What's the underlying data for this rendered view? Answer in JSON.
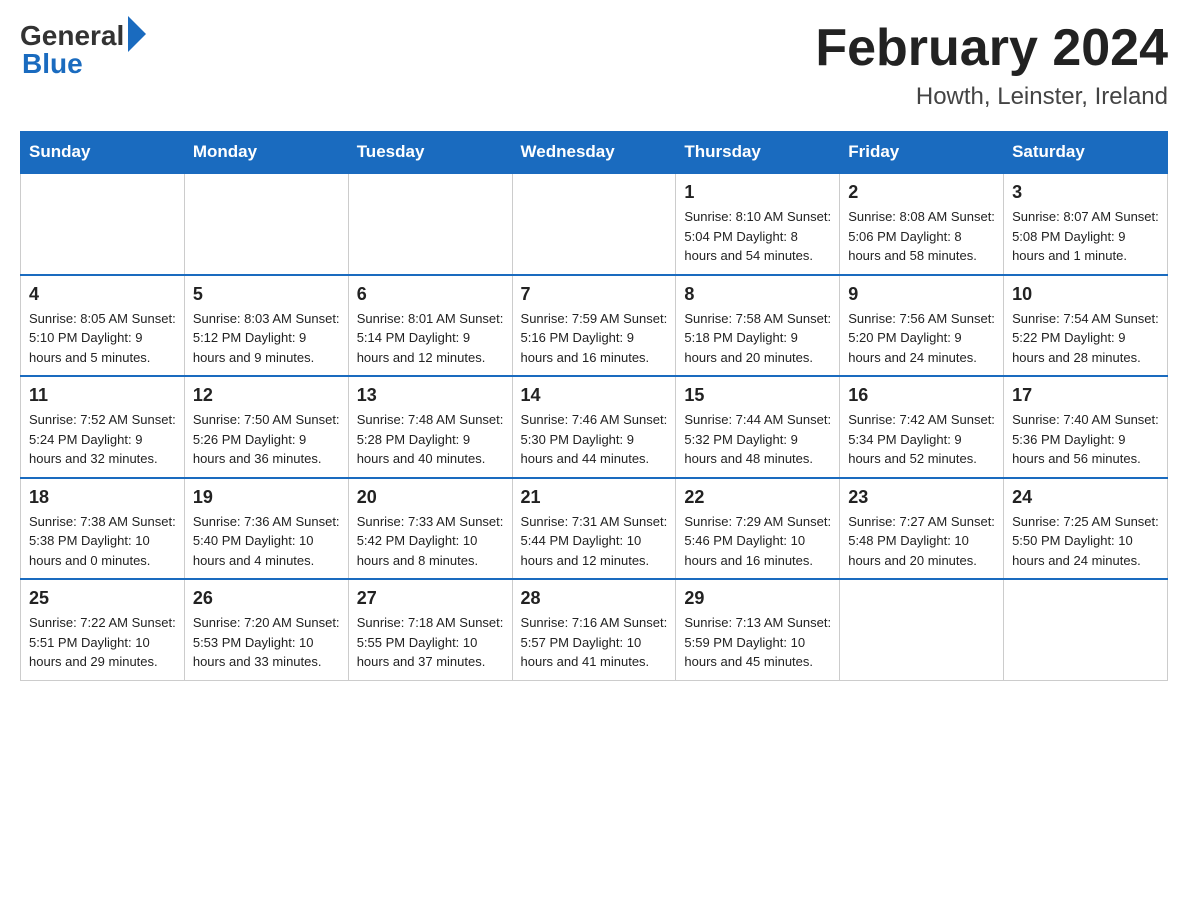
{
  "header": {
    "logo_general": "General",
    "logo_blue": "Blue",
    "title": "February 2024",
    "subtitle": "Howth, Leinster, Ireland"
  },
  "days_of_week": [
    "Sunday",
    "Monday",
    "Tuesday",
    "Wednesday",
    "Thursday",
    "Friday",
    "Saturday"
  ],
  "weeks": [
    [
      {
        "day": "",
        "info": ""
      },
      {
        "day": "",
        "info": ""
      },
      {
        "day": "",
        "info": ""
      },
      {
        "day": "",
        "info": ""
      },
      {
        "day": "1",
        "info": "Sunrise: 8:10 AM\nSunset: 5:04 PM\nDaylight: 8 hours\nand 54 minutes."
      },
      {
        "day": "2",
        "info": "Sunrise: 8:08 AM\nSunset: 5:06 PM\nDaylight: 8 hours\nand 58 minutes."
      },
      {
        "day": "3",
        "info": "Sunrise: 8:07 AM\nSunset: 5:08 PM\nDaylight: 9 hours\nand 1 minute."
      }
    ],
    [
      {
        "day": "4",
        "info": "Sunrise: 8:05 AM\nSunset: 5:10 PM\nDaylight: 9 hours\nand 5 minutes."
      },
      {
        "day": "5",
        "info": "Sunrise: 8:03 AM\nSunset: 5:12 PM\nDaylight: 9 hours\nand 9 minutes."
      },
      {
        "day": "6",
        "info": "Sunrise: 8:01 AM\nSunset: 5:14 PM\nDaylight: 9 hours\nand 12 minutes."
      },
      {
        "day": "7",
        "info": "Sunrise: 7:59 AM\nSunset: 5:16 PM\nDaylight: 9 hours\nand 16 minutes."
      },
      {
        "day": "8",
        "info": "Sunrise: 7:58 AM\nSunset: 5:18 PM\nDaylight: 9 hours\nand 20 minutes."
      },
      {
        "day": "9",
        "info": "Sunrise: 7:56 AM\nSunset: 5:20 PM\nDaylight: 9 hours\nand 24 minutes."
      },
      {
        "day": "10",
        "info": "Sunrise: 7:54 AM\nSunset: 5:22 PM\nDaylight: 9 hours\nand 28 minutes."
      }
    ],
    [
      {
        "day": "11",
        "info": "Sunrise: 7:52 AM\nSunset: 5:24 PM\nDaylight: 9 hours\nand 32 minutes."
      },
      {
        "day": "12",
        "info": "Sunrise: 7:50 AM\nSunset: 5:26 PM\nDaylight: 9 hours\nand 36 minutes."
      },
      {
        "day": "13",
        "info": "Sunrise: 7:48 AM\nSunset: 5:28 PM\nDaylight: 9 hours\nand 40 minutes."
      },
      {
        "day": "14",
        "info": "Sunrise: 7:46 AM\nSunset: 5:30 PM\nDaylight: 9 hours\nand 44 minutes."
      },
      {
        "day": "15",
        "info": "Sunrise: 7:44 AM\nSunset: 5:32 PM\nDaylight: 9 hours\nand 48 minutes."
      },
      {
        "day": "16",
        "info": "Sunrise: 7:42 AM\nSunset: 5:34 PM\nDaylight: 9 hours\nand 52 minutes."
      },
      {
        "day": "17",
        "info": "Sunrise: 7:40 AM\nSunset: 5:36 PM\nDaylight: 9 hours\nand 56 minutes."
      }
    ],
    [
      {
        "day": "18",
        "info": "Sunrise: 7:38 AM\nSunset: 5:38 PM\nDaylight: 10 hours\nand 0 minutes."
      },
      {
        "day": "19",
        "info": "Sunrise: 7:36 AM\nSunset: 5:40 PM\nDaylight: 10 hours\nand 4 minutes."
      },
      {
        "day": "20",
        "info": "Sunrise: 7:33 AM\nSunset: 5:42 PM\nDaylight: 10 hours\nand 8 minutes."
      },
      {
        "day": "21",
        "info": "Sunrise: 7:31 AM\nSunset: 5:44 PM\nDaylight: 10 hours\nand 12 minutes."
      },
      {
        "day": "22",
        "info": "Sunrise: 7:29 AM\nSunset: 5:46 PM\nDaylight: 10 hours\nand 16 minutes."
      },
      {
        "day": "23",
        "info": "Sunrise: 7:27 AM\nSunset: 5:48 PM\nDaylight: 10 hours\nand 20 minutes."
      },
      {
        "day": "24",
        "info": "Sunrise: 7:25 AM\nSunset: 5:50 PM\nDaylight: 10 hours\nand 24 minutes."
      }
    ],
    [
      {
        "day": "25",
        "info": "Sunrise: 7:22 AM\nSunset: 5:51 PM\nDaylight: 10 hours\nand 29 minutes."
      },
      {
        "day": "26",
        "info": "Sunrise: 7:20 AM\nSunset: 5:53 PM\nDaylight: 10 hours\nand 33 minutes."
      },
      {
        "day": "27",
        "info": "Sunrise: 7:18 AM\nSunset: 5:55 PM\nDaylight: 10 hours\nand 37 minutes."
      },
      {
        "day": "28",
        "info": "Sunrise: 7:16 AM\nSunset: 5:57 PM\nDaylight: 10 hours\nand 41 minutes."
      },
      {
        "day": "29",
        "info": "Sunrise: 7:13 AM\nSunset: 5:59 PM\nDaylight: 10 hours\nand 45 minutes."
      },
      {
        "day": "",
        "info": ""
      },
      {
        "day": "",
        "info": ""
      }
    ]
  ]
}
